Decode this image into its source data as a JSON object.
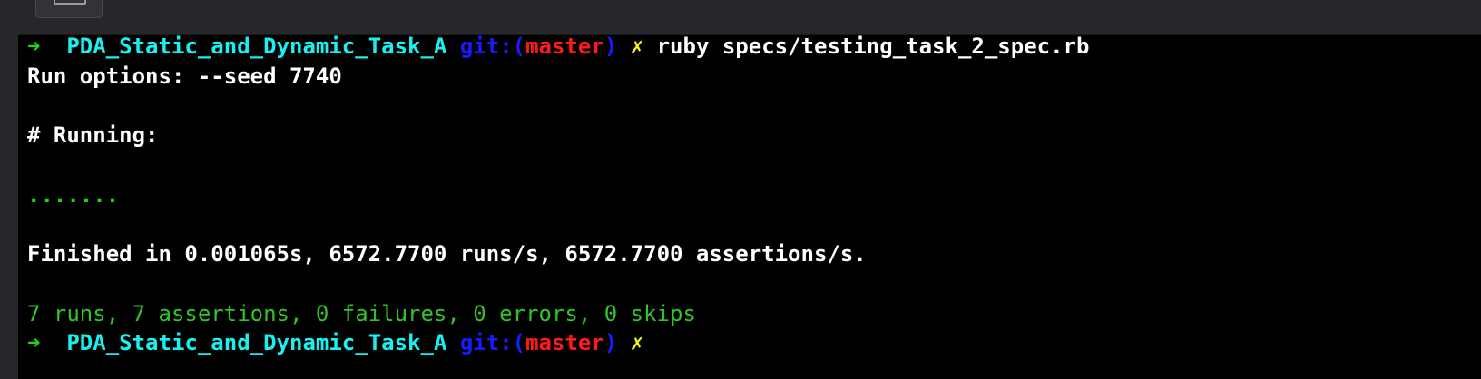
{
  "terminal": {
    "prompt1": {
      "arrow": "➜",
      "directory": "PDA_Static_and_Dynamic_Task_A",
      "git_prefix": "git:(",
      "branch": "master",
      "git_suffix": ")",
      "dirty_mark": "✗",
      "command": "ruby specs/testing_task_2_spec.rb"
    },
    "run_options": "Run options: --seed 7740",
    "running_header": "# Running:",
    "progress_dots": ".......",
    "finished_line": "Finished in 0.001065s, 6572.7700 runs/s, 6572.7700 assertions/s.",
    "summary_line": "7 runs, 7 assertions, 0 failures, 0 errors, 0 skips",
    "prompt2": {
      "arrow": "➜",
      "directory": "PDA_Static_and_Dynamic_Task_A",
      "git_prefix": "git:(",
      "branch": "master",
      "git_suffix": ")",
      "dirty_mark": "✗"
    }
  },
  "colors": {
    "background": "#000000",
    "arrow": "#1fd615",
    "directory": "#19f0f0",
    "git_label": "#1a1aff",
    "branch": "#ff1a1a",
    "dirty_mark": "#f5f51a",
    "text": "#ffffff",
    "success": "#2fc52a"
  }
}
